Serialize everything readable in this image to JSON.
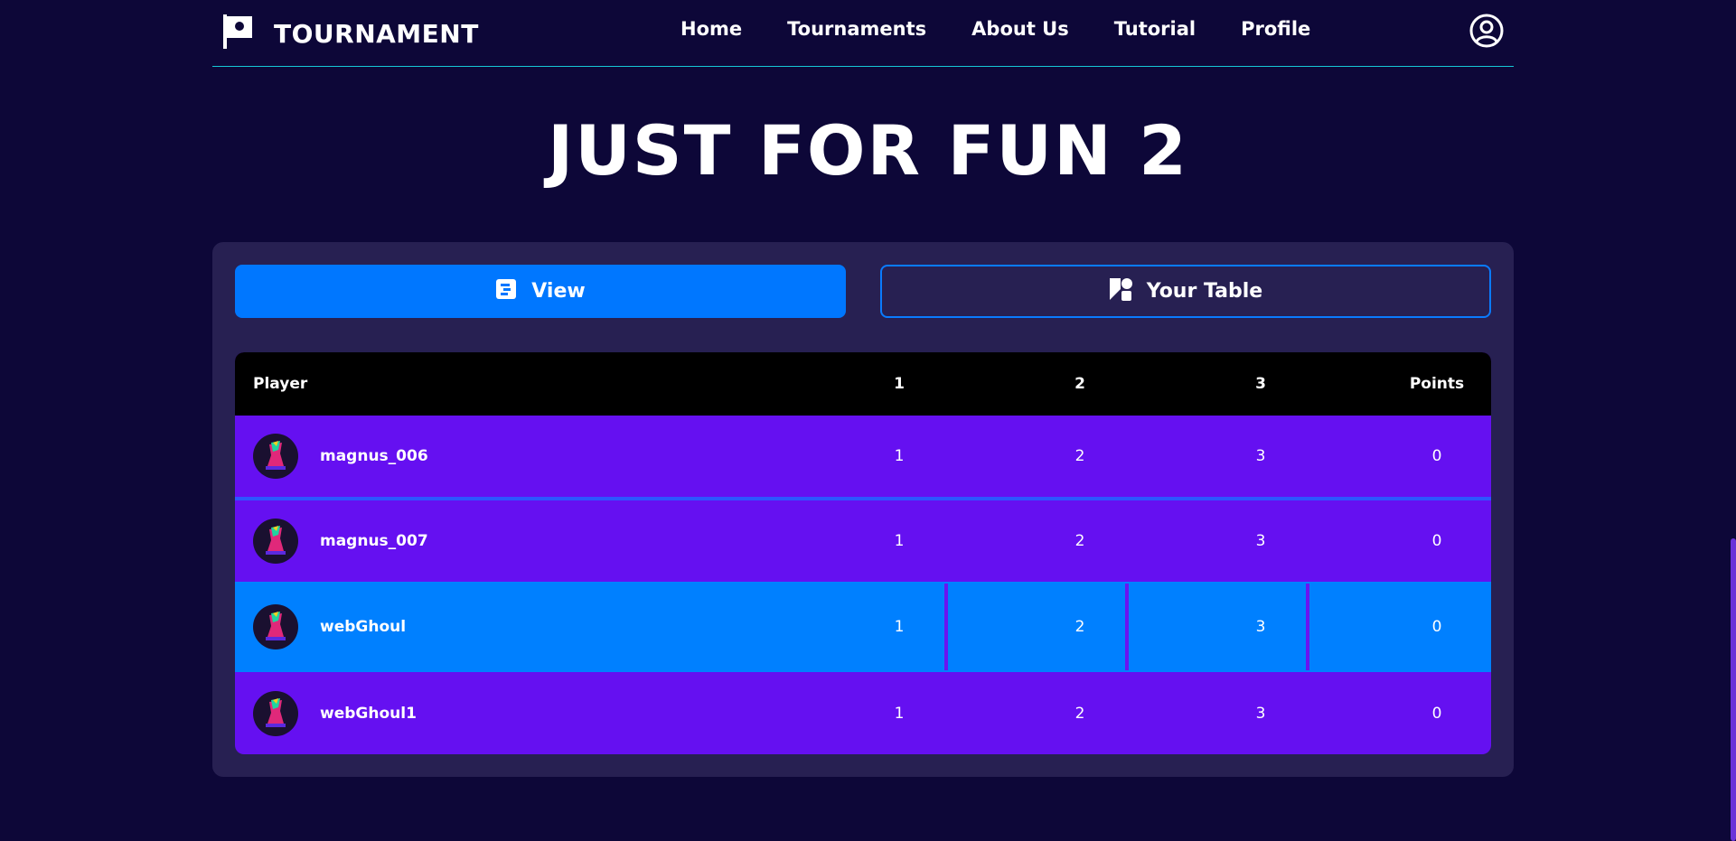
{
  "header": {
    "brand": "TOURNAMENT",
    "nav": [
      "Home",
      "Tournaments",
      "About Us",
      "Tutorial",
      "Profile"
    ]
  },
  "page_title": "JUST FOR FUN 2",
  "tabs": {
    "view": "View",
    "your_table": "Your Table"
  },
  "table": {
    "columns": [
      "Player",
      "1",
      "2",
      "3",
      "Points"
    ],
    "rows": [
      {
        "player": "magnus_006",
        "r1": "1",
        "r2": "2",
        "r3": "3",
        "points": "0"
      },
      {
        "player": "magnus_007",
        "r1": "1",
        "r2": "2",
        "r3": "3",
        "points": "0"
      },
      {
        "player": "webGhoul",
        "r1": "1",
        "r2": "2",
        "r3": "3",
        "points": "0"
      },
      {
        "player": "webGhoul1",
        "r1": "1",
        "r2": "2",
        "r3": "3",
        "points": "0"
      }
    ]
  },
  "colors": {
    "background": "#0d0738",
    "card": "#272052",
    "accent": "#0077ff",
    "row": "#6510f1",
    "header_line": "#15c7d6"
  }
}
